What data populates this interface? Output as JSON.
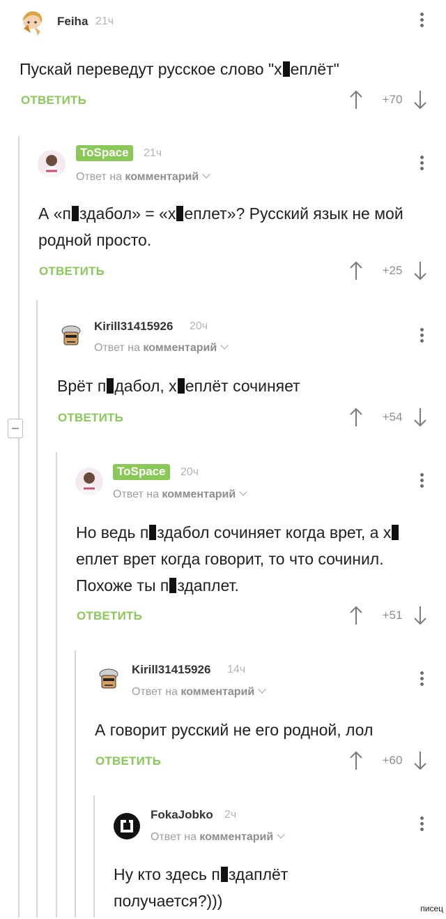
{
  "comments": [
    {
      "author": "Feiha",
      "time": "21ч",
      "text_parts": [
        "Пускай переведут русское слово \"х",
        "[c]",
        "еплёт\""
      ],
      "reply_label": "ОТВЕТИТЬ",
      "score": "+70"
    },
    {
      "author": "ToSpace",
      "time": "21ч",
      "reply_prefix": "Ответ на",
      "reply_target": "комментарий",
      "text": "А «п▮здабол» = «х▮еплет»? Русский язык не мой родной просто.",
      "reply_label": "ОТВЕТИТЬ",
      "score": "+25"
    },
    {
      "author": "Kirill31415926",
      "time": "20ч",
      "reply_prefix": "Ответ на",
      "reply_target": "комментарий",
      "text": "Врёт п▮дабол, х▮еплёт сочиняет",
      "reply_label": "ОТВЕТИТЬ",
      "score": "+54"
    },
    {
      "author": "ToSpace",
      "time": "20ч",
      "reply_prefix": "Ответ на",
      "reply_target": "комментарий",
      "text": "Но ведь п▮здабол сочиняет когда врет, а х▮еплет врет когда говорит, то что сочинил. Похоже ты п▮здаплет.",
      "reply_label": "ОТВЕТИТЬ",
      "score": "+51"
    },
    {
      "author": "Kirill31415926",
      "time": "14ч",
      "reply_prefix": "Ответ на",
      "reply_target": "комментарий",
      "text": "А говорит русский не его родной, лол",
      "reply_label": "ОТВЕТИТЬ",
      "score": "+60"
    },
    {
      "author": "FokaJobko",
      "time": "2ч",
      "reply_prefix": "Ответ на",
      "reply_target": "комментарий",
      "text": "Ну кто здесь п▮здаплёт получается?)))"
    }
  ],
  "watermark": "писец",
  "colors": {
    "accent": "#8ac858",
    "muted": "#9e9e9e",
    "text": "#1f1f1f",
    "censor": "#111111"
  },
  "icons": [
    "more-vertical-icon",
    "arrow-up-icon",
    "arrow-down-icon",
    "chevron-down-icon",
    "collapse-minus-icon"
  ]
}
